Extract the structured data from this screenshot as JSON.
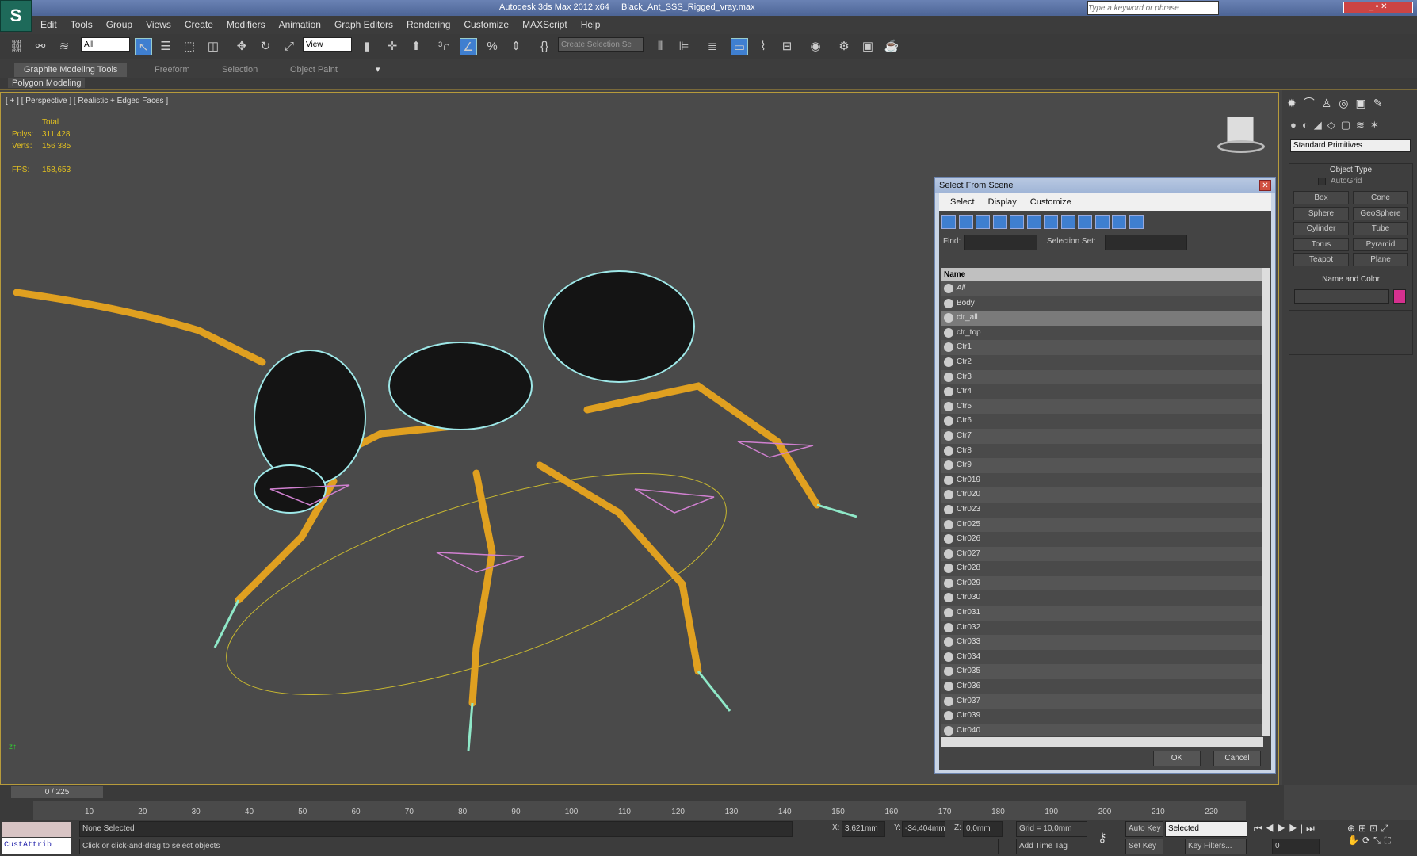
{
  "app": {
    "title": "Autodesk 3ds Max  2012 x64",
    "file": "Black_Ant_SSS_Rigged_vray.max",
    "search_placeholder": "Type a keyword or phrase",
    "logo": "S"
  },
  "menu": [
    "Edit",
    "Tools",
    "Group",
    "Views",
    "Create",
    "Modifiers",
    "Animation",
    "Graph Editors",
    "Rendering",
    "Customize",
    "MAXScript",
    "Help"
  ],
  "toolbar": {
    "filter": "All",
    "ref_coord": "View",
    "selection_set": "Create Selection Se"
  },
  "ribbon": {
    "tabs": [
      "Graphite Modeling Tools",
      "Freeform",
      "Selection",
      "Object Paint"
    ],
    "panel": "Polygon Modeling"
  },
  "viewport": {
    "label": "[ + ] [ Perspective ] [ Realistic + Edged Faces ]",
    "total": "Total",
    "polys_label": "Polys:",
    "polys": "311 428",
    "verts_label": "Verts:",
    "verts": "156 385",
    "fps_label": "FPS:",
    "fps": "158,653"
  },
  "dialog": {
    "title": "Select From Scene",
    "menu": [
      "Select",
      "Display",
      "Customize"
    ],
    "find_label": "Find:",
    "selset_label": "Selection Set:",
    "column": "Name",
    "ok": "OK",
    "cancel": "Cancel",
    "items": [
      "All",
      "Body",
      "ctr_all",
      "ctr_top",
      "Ctr1",
      "Ctr2",
      "Ctr3",
      "Ctr4",
      "Ctr5",
      "Ctr6",
      "Ctr7",
      "Ctr8",
      "Ctr9",
      "Ctr019",
      "Ctr020",
      "Ctr023",
      "Ctr025",
      "Ctr026",
      "Ctr027",
      "Ctr028",
      "Ctr029",
      "Ctr030",
      "Ctr031",
      "Ctr032",
      "Ctr033",
      "Ctr034",
      "Ctr035",
      "Ctr036",
      "Ctr037",
      "Ctr039",
      "Ctr040"
    ],
    "selected": "ctr_all"
  },
  "panel": {
    "category": "Standard Primitives",
    "object_type": "Object Type",
    "autogrid": "AutoGrid",
    "buttons": [
      "Box",
      "Cone",
      "Sphere",
      "GeoSphere",
      "Cylinder",
      "Tube",
      "Torus",
      "Pyramid",
      "Teapot",
      "Plane"
    ],
    "name_color": "Name and Color",
    "color": "#d6308f"
  },
  "timeline": {
    "frame": "0 / 225",
    "ticks": [
      "10",
      "20",
      "30",
      "40",
      "50",
      "60",
      "70",
      "80",
      "90",
      "100",
      "110",
      "120",
      "130",
      "140",
      "150",
      "160",
      "170",
      "180",
      "190",
      "200",
      "210",
      "220"
    ]
  },
  "status": {
    "script": "CustAttrib",
    "selection": "None Selected",
    "prompt": "Click or click-and-drag to select objects",
    "x_label": "X:",
    "x": "3,621mm",
    "y_label": "Y:",
    "y": "-34,404mm",
    "z_label": "Z:",
    "z": "0,0mm",
    "grid": "Grid = 10,0mm",
    "add_time_tag": "Add Time Tag",
    "auto_key": "Auto Key",
    "set_key": "Set Key",
    "key_mode": "Selected",
    "key_filters": "Key Filters...",
    "frame_field": "0"
  }
}
